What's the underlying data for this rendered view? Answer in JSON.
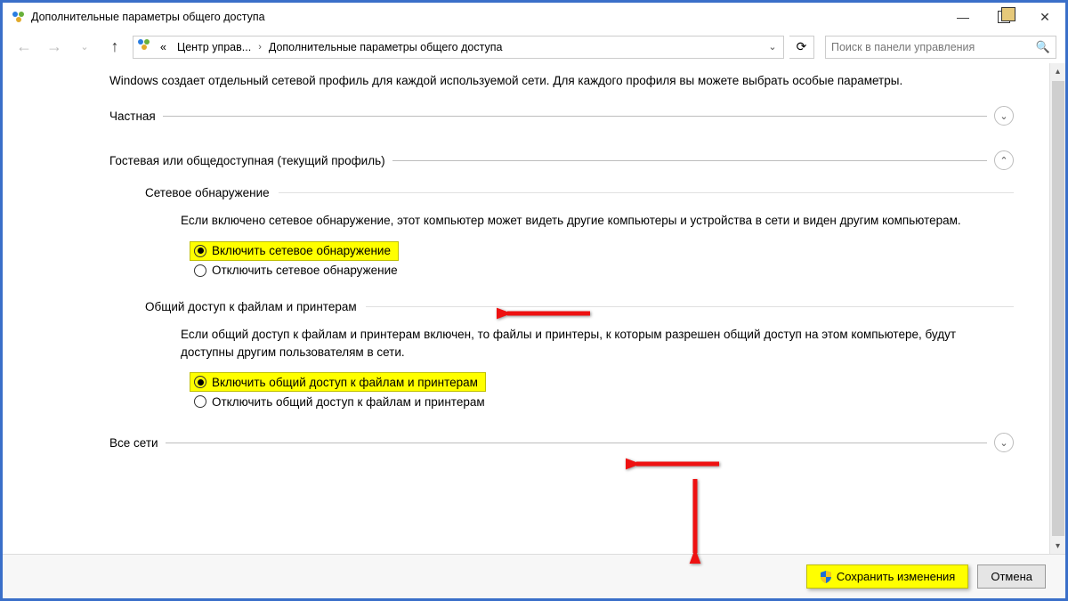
{
  "window": {
    "title": "Дополнительные параметры общего доступа"
  },
  "breadcrumb": {
    "ellipsis": "«",
    "item1": "Центр управ...",
    "item2": "Дополнительные параметры общего доступа"
  },
  "search": {
    "placeholder": "Поиск в панели управления"
  },
  "intro": "Windows создает отдельный сетевой профиль для каждой используемой сети. Для каждого профиля вы можете выбрать особые параметры.",
  "profiles": {
    "private": "Частная",
    "guest": "Гостевая или общедоступная (текущий профиль)",
    "all": "Все сети"
  },
  "discovery": {
    "header": "Сетевое обнаружение",
    "desc": "Если включено сетевое обнаружение, этот компьютер может видеть другие компьютеры и устройства в сети и виден другим компьютерам.",
    "on": "Включить сетевое обнаружение",
    "off": "Отключить сетевое обнаружение"
  },
  "sharing": {
    "header": "Общий доступ к файлам и принтерам",
    "desc": "Если общий доступ к файлам и принтерам включен, то файлы и принтеры, к которым разрешен общий доступ на этом компьютере, будут доступны другим пользователям в сети.",
    "on": "Включить общий доступ к файлам и принтерам",
    "off": "Отключить общий доступ к файлам и принтерам"
  },
  "footer": {
    "save": "Сохранить изменения",
    "cancel": "Отмена"
  }
}
